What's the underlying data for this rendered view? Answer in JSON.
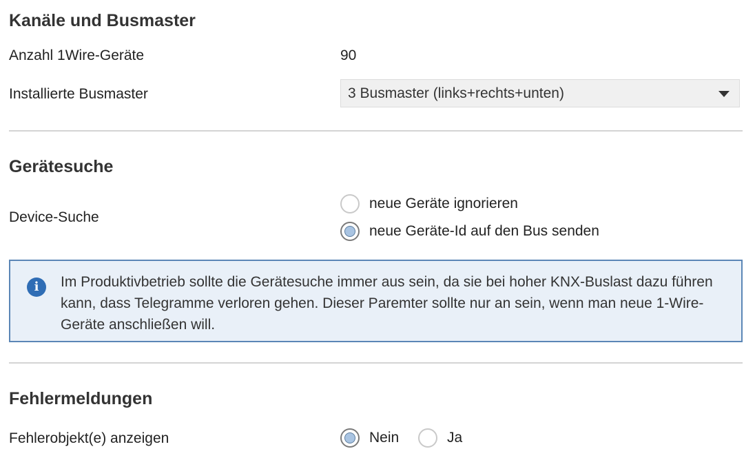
{
  "sections": {
    "channels": {
      "title": "Kanäle und Busmaster",
      "device_count_label": "Anzahl 1Wire-Geräte",
      "device_count_value": "90",
      "busmaster_label": "Installierte Busmaster",
      "busmaster_selected": "3 Busmaster (links+rechts+unten)"
    },
    "search": {
      "title": "Gerätesuche",
      "device_search_label": "Device-Suche",
      "options": [
        {
          "label": "neue Geräte ignorieren",
          "checked": false
        },
        {
          "label": "neue Geräte-Id auf den Bus senden",
          "checked": true
        }
      ],
      "info_icon": "info-icon",
      "info_text": "Im Produktivbetrieb sollte die Gerätesuche immer aus sein, da sie bei hoher KNX-Buslast dazu führen kann, dass Telegramme verloren gehen. Dieser Paremter sollte nur an sein, wenn man neue 1-Wire-Geräte anschließen will."
    },
    "errors": {
      "title": "Fehlermeldungen",
      "error_objects_label": "Fehlerobjekt(e) anzeigen",
      "options": [
        {
          "label": "Nein",
          "checked": true
        },
        {
          "label": "Ja",
          "checked": false
        }
      ]
    }
  },
  "colors": {
    "info_border": "#5b86b6",
    "info_background": "#e9f0f8",
    "info_icon": "#2f6db5",
    "radio_checked_fill": "#a9c4e2"
  }
}
